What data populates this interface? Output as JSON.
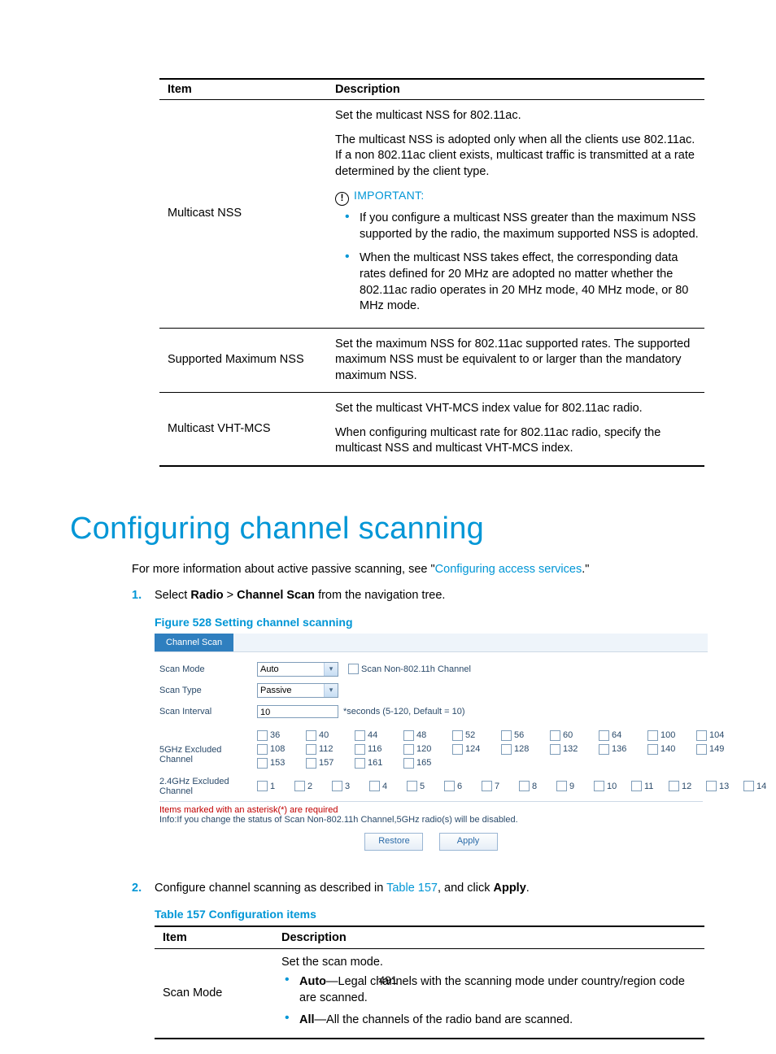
{
  "table1": {
    "head_item": "Item",
    "head_desc": "Description",
    "rows": [
      {
        "item": "Multicast NSS",
        "p1": "Set the multicast NSS for 802.11ac.",
        "p2": "The multicast NSS is adopted only when all the clients use 802.11ac. If a non 802.11ac client exists, multicast traffic is transmitted at a rate determined by the client type.",
        "important_label": "IMPORTANT:",
        "b1": "If you configure a multicast NSS greater than the maximum NSS supported by the radio, the maximum supported NSS is adopted.",
        "b2": "When the multicast NSS takes effect, the corresponding data rates defined for 20 MHz are adopted no matter whether the 802.11ac radio operates in 20 MHz mode, 40 MHz mode, or 80 MHz mode."
      },
      {
        "item": "Supported  Maximum NSS",
        "p1": "Set the maximum NSS for 802.11ac supported rates. The supported maximum NSS must be equivalent to or larger than the mandatory maximum NSS."
      },
      {
        "item": "Multicast VHT-MCS",
        "p1": "Set the multicast VHT-MCS index value for 802.11ac radio.",
        "p2": "When configuring multicast rate for 802.11ac radio, specify the multicast NSS and multicast VHT-MCS index."
      }
    ]
  },
  "heading": "Configuring channel scanning",
  "intro_pre": "For more information about active passive scanning, see \"",
  "intro_link": "Configuring access services",
  "intro_post": ".\"",
  "step1_num": "1.",
  "step1_pre": "Select ",
  "step1_b1": "Radio",
  "step1_mid": " > ",
  "step1_b2": "Channel Scan",
  "step1_post": " from the navigation tree.",
  "fig_caption": "Figure 528 Setting channel scanning",
  "ui": {
    "tab": "Channel Scan",
    "scan_mode_label": "Scan Mode",
    "scan_mode_value": "Auto",
    "scan_non80211h_label": "Scan Non-802.11h Channel",
    "scan_type_label": "Scan Type",
    "scan_type_value": "Passive",
    "scan_interval_label": "Scan Interval",
    "scan_interval_value": "10",
    "scan_interval_hint": "*seconds (5-120, Default = 10)",
    "excl5_label": "5GHz Excluded Channel",
    "excl5_rows": [
      [
        "36",
        "40",
        "44",
        "48",
        "52",
        "56",
        "60",
        "64",
        "100",
        "104"
      ],
      [
        "108",
        "112",
        "116",
        "120",
        "124",
        "128",
        "132",
        "136",
        "140",
        "149"
      ],
      [
        "153",
        "157",
        "161",
        "165"
      ]
    ],
    "excl24_label": "2.4GHz Excluded Channel",
    "excl24": [
      "1",
      "2",
      "3",
      "4",
      "5",
      "6",
      "7",
      "8",
      "9",
      "10",
      "11",
      "12",
      "13",
      "14"
    ],
    "note_required": "Items marked with an asterisk(*) are required",
    "note_info": "Info:If you change the status of Scan Non-802.11h Channel,5GHz radio(s) will be disabled.",
    "btn_restore": "Restore",
    "btn_apply": "Apply"
  },
  "step2_num": "2.",
  "step2_pre": "Configure channel scanning as described in ",
  "step2_link": "Table 157",
  "step2_mid": ", and click ",
  "step2_b": "Apply",
  "step2_post": ".",
  "tbl2_caption": "Table 157 Configuration items",
  "table2": {
    "head_item": "Item",
    "head_desc": "Description",
    "row_item": "Scan Mode",
    "row_p1": "Set the scan mode.",
    "row_b1_bold": "Auto",
    "row_b1_rest": "—Legal channels with the scanning mode under country/region code are scanned.",
    "row_b2_bold": "All",
    "row_b2_rest": "—All the channels of the radio band are scanned."
  },
  "page_number": "491"
}
